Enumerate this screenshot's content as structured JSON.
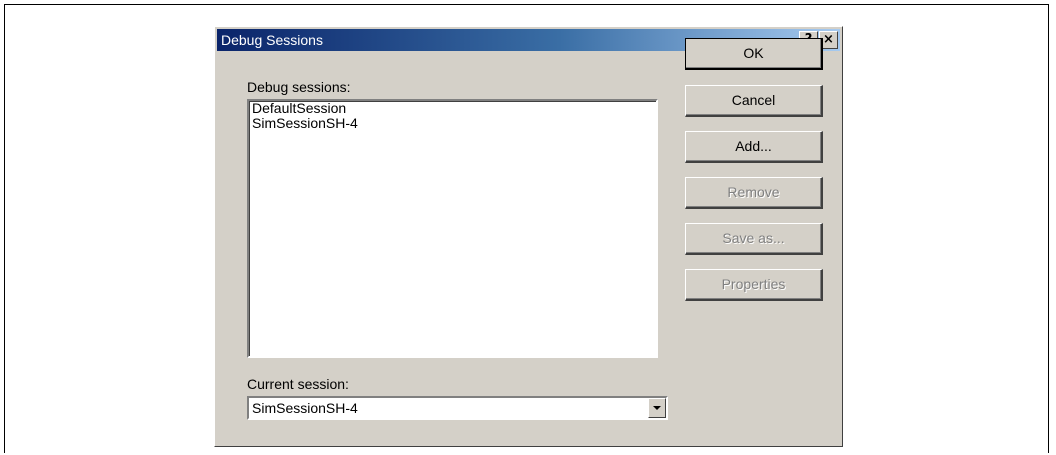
{
  "window": {
    "title": "Debug Sessions",
    "help_glyph": "?",
    "close_glyph": "×"
  },
  "sessions_label": "Debug sessions:",
  "sessions": [
    "DefaultSession",
    "SimSessionSH-4"
  ],
  "current_session": {
    "label": "Current session:",
    "value": "SimSessionSH-4"
  },
  "buttons": {
    "ok": "OK",
    "cancel": "Cancel",
    "add": "Add...",
    "remove": "Remove",
    "save_as": "Save as...",
    "properties": "Properties"
  },
  "icons": {
    "help": "help-icon",
    "close": "close-icon",
    "dropdown": "chevron-down-icon"
  }
}
